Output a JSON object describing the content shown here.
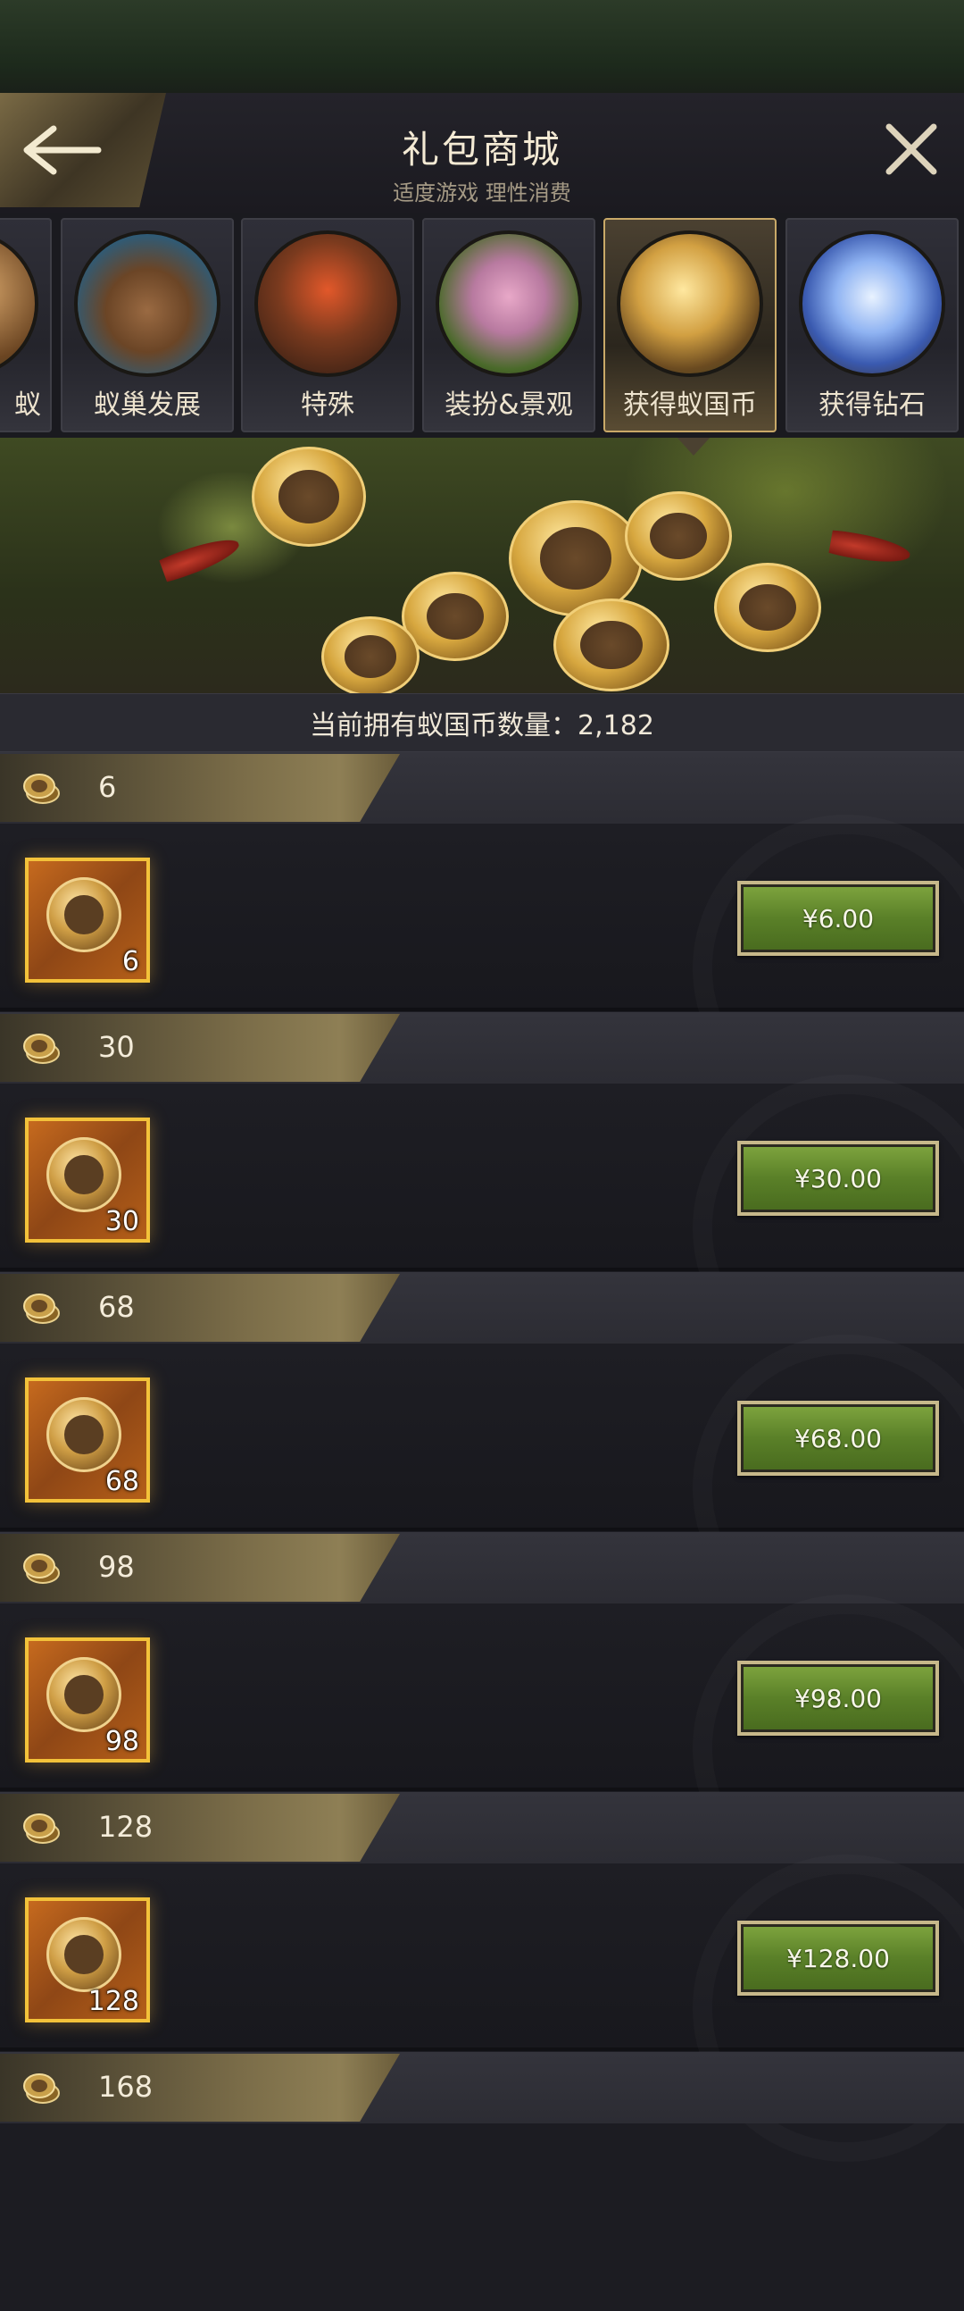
{
  "header": {
    "title": "礼包商城",
    "subtitle": "适度游戏 理性消费"
  },
  "tabs": [
    {
      "label": "蚁",
      "active": false
    },
    {
      "label": "蚁巢发展",
      "active": false
    },
    {
      "label": "特殊",
      "active": false
    },
    {
      "label": "装扮&景观",
      "active": false
    },
    {
      "label": "获得蚁国币",
      "active": true
    },
    {
      "label": "获得钻石",
      "active": false
    }
  ],
  "balance": {
    "text": "当前拥有蚁国币数量：2,182"
  },
  "packs": [
    {
      "amount": "6",
      "count": "6",
      "price": "¥6.00"
    },
    {
      "amount": "30",
      "count": "30",
      "price": "¥30.00"
    },
    {
      "amount": "68",
      "count": "68",
      "price": "¥68.00"
    },
    {
      "amount": "98",
      "count": "98",
      "price": "¥98.00"
    },
    {
      "amount": "128",
      "count": "128",
      "price": "¥128.00"
    },
    {
      "amount": "168"
    }
  ],
  "colors": {
    "accent_gold": "#c9a968",
    "price_green": "#5a8028",
    "card_orange": "#c66a1e"
  }
}
